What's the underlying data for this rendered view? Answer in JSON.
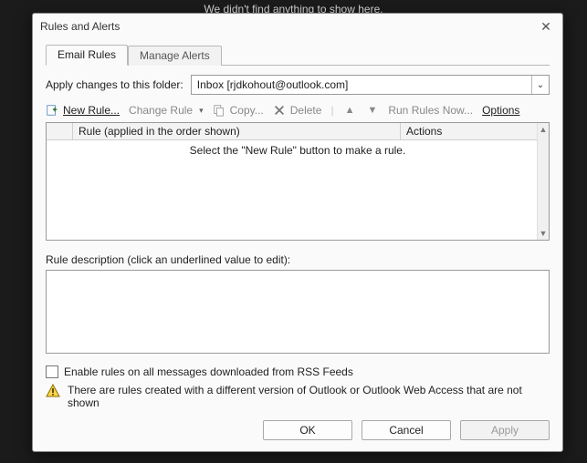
{
  "background_note": "We didn't find anything to show here.",
  "dialog": {
    "title": "Rules and Alerts",
    "tabs": [
      {
        "label": "Email Rules",
        "active": true
      },
      {
        "label": "Manage Alerts",
        "active": false
      }
    ],
    "folder_label": "Apply changes to this folder:",
    "folder_value": "Inbox [rjdkohout@outlook.com]",
    "toolbar": {
      "new_rule": "New Rule...",
      "change_rule": "Change Rule",
      "copy": "Copy...",
      "delete": "Delete",
      "run_rules": "Run Rules Now...",
      "options": "Options"
    },
    "table": {
      "col_rule": "Rule (applied in the order shown)",
      "col_actions": "Actions",
      "empty_msg": "Select the \"New Rule\" button to make a rule."
    },
    "description_label": "Rule description (click an underlined value to edit):",
    "rss_checkbox_label": "Enable rules on all messages downloaded from RSS Feeds",
    "warning_text": "There are rules created with a different version of Outlook or Outlook Web Access that are not shown",
    "buttons": {
      "ok": "OK",
      "cancel": "Cancel",
      "apply": "Apply"
    }
  }
}
